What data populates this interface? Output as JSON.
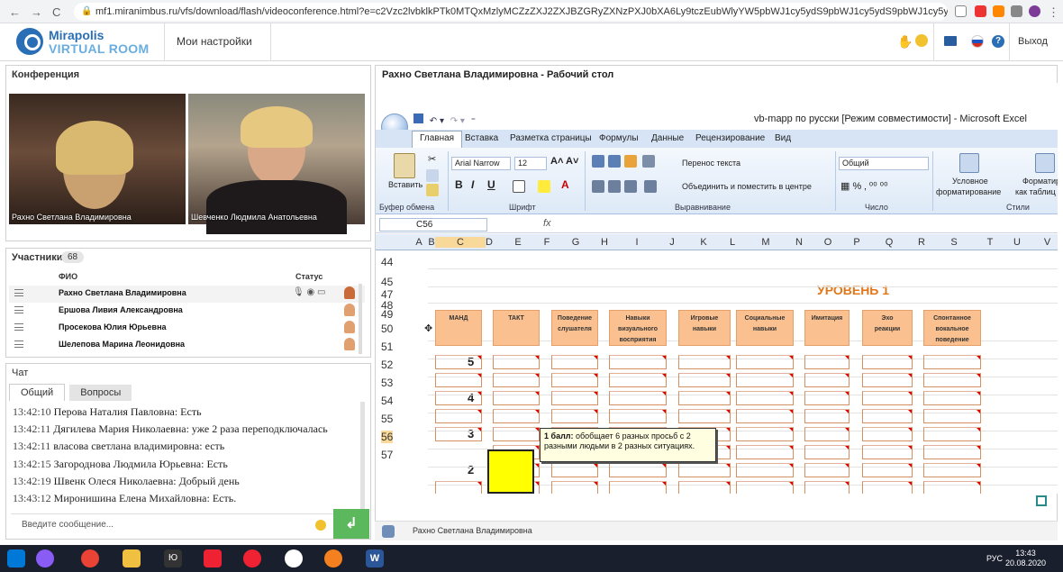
{
  "browser": {
    "url": "mf1.miranimbus.ru/vfs/download/flash/videoconference.html?e=c2Vzc2lvbklkPTk0MTQxMzlyMCZzZXJ2ZXJBZGRyZXNzPXJ0bXA6Ly9tczEubWlyYW5pbWJ1cy5ydS9pbWJ1cy5ydS9pbWJ1cy5ydS",
    "nav": {
      "back": "←",
      "forward": "→",
      "reload": "C",
      "home": "⌂"
    }
  },
  "app": {
    "logo_line1": "Mirapolis",
    "logo_line2": "VIRTUAL ROOM",
    "settings_label": "Мои настройки",
    "exit_label": "Выход"
  },
  "conference": {
    "title": "Конференция",
    "videos": [
      {
        "label": "Рахно Светлана Владимировна"
      },
      {
        "label": "Шевченко  Людмила  Анатольевна"
      }
    ]
  },
  "participants": {
    "title": "Участники",
    "count": "68",
    "col_name": "ФИО",
    "col_status": "Статус",
    "rows": [
      {
        "name": "Рахно Светлана Владимировна",
        "status": "🎙 ◉ ▭"
      },
      {
        "name": "Ершова Ливия Александровна",
        "status": ""
      },
      {
        "name": "Просекова  Юлия  Юрьевна",
        "status": ""
      },
      {
        "name": "Шелепова  Марина Леонидовна",
        "status": ""
      }
    ]
  },
  "chat": {
    "title": "Чат",
    "tab_general": "Общий",
    "tab_questions": "Вопросы",
    "messages": [
      {
        "time": "13:42:10",
        "text": "Перова  Наталия  Павловна: Есть"
      },
      {
        "time": "13:42:11",
        "text": "Дягилева Мария Николаевна: уже 2 раза переподключалась"
      },
      {
        "time": "13:42:11",
        "text": "власова светлана  владимировна: есть"
      },
      {
        "time": "13:42:15",
        "text": "Загороднова  Людмила Юрьевна:  Есть"
      },
      {
        "time": "13:42:19",
        "text": "Швенк  Олеся Николаевна: Добрый день"
      },
      {
        "time": "13:43:12",
        "text": "Миронишина Елена  Михайловна: Есть."
      }
    ],
    "input_placeholder": "Введите сообщение...",
    "send_label": "↲"
  },
  "desktop": {
    "title": "Рахно Светлана Владимировна - Рабочий стол",
    "footer_name": "Рахно Светлана Владимировна"
  },
  "excel": {
    "window_title": "vb-mapp по русски  [Режим совместимости] - Microsoft Excel",
    "tabs": [
      "Главная",
      "Вставка",
      "Разметка страницы",
      "Формулы",
      "Данные",
      "Рецензирование",
      "Вид"
    ],
    "paste_label": "Вставить",
    "font_name": "Arial Narrow",
    "font_size": "12",
    "wrap_text": "Перенос текста",
    "merge_center": "Объединить и поместить в центре",
    "number_format": "Общий",
    "cond_format_1": "Условное",
    "cond_format_2": "форматирование",
    "format_table_1": "Форматиров",
    "format_table_2": "как таблиц",
    "groups": {
      "clipboard": "Буфер обмена",
      "font": "Шрифт",
      "alignment": "Выравнивание",
      "number": "Число",
      "styles": "Стили"
    },
    "name_box": "C56",
    "fx": "fx",
    "columns": [
      "A",
      "B",
      "C",
      "D",
      "E",
      "F",
      "G",
      "H",
      "I",
      "J",
      "K",
      "L",
      "M",
      "N",
      "O",
      "P",
      "Q",
      "R",
      "S",
      "T",
      "U",
      "V"
    ],
    "rows": [
      "44",
      "45",
      "47",
      "48",
      "49",
      "50",
      "51",
      "52",
      "53",
      "54",
      "55",
      "56",
      "57"
    ],
    "level_title": "УРОВЕНЬ 1",
    "headers": [
      {
        "l1": "МАНД",
        "l2": ""
      },
      {
        "l1": "ТАКТ",
        "l2": ""
      },
      {
        "l1": "Поведение",
        "l2": "слушателя"
      },
      {
        "l1": "Навыки",
        "l2": "визуального восприятия"
      },
      {
        "l1": "Игровые",
        "l2": "навыки"
      },
      {
        "l1": "Социальные",
        "l2": "навыки"
      },
      {
        "l1": "Имитация",
        "l2": ""
      },
      {
        "l1": "Эхо",
        "l2": "реакции"
      },
      {
        "l1": "Спонтанное",
        "l2": "вокальное поведение"
      }
    ],
    "score_labels": [
      "5",
      "4",
      "3",
      "2"
    ],
    "tooltip_bold": "1 балл:",
    "tooltip_text": " обобщает 6 разных просьб с 2 разными людьми в 2 разных ситуациях."
  },
  "taskbar": {
    "lang": "РУС",
    "time": "13:43",
    "date": "20.08.2020"
  }
}
